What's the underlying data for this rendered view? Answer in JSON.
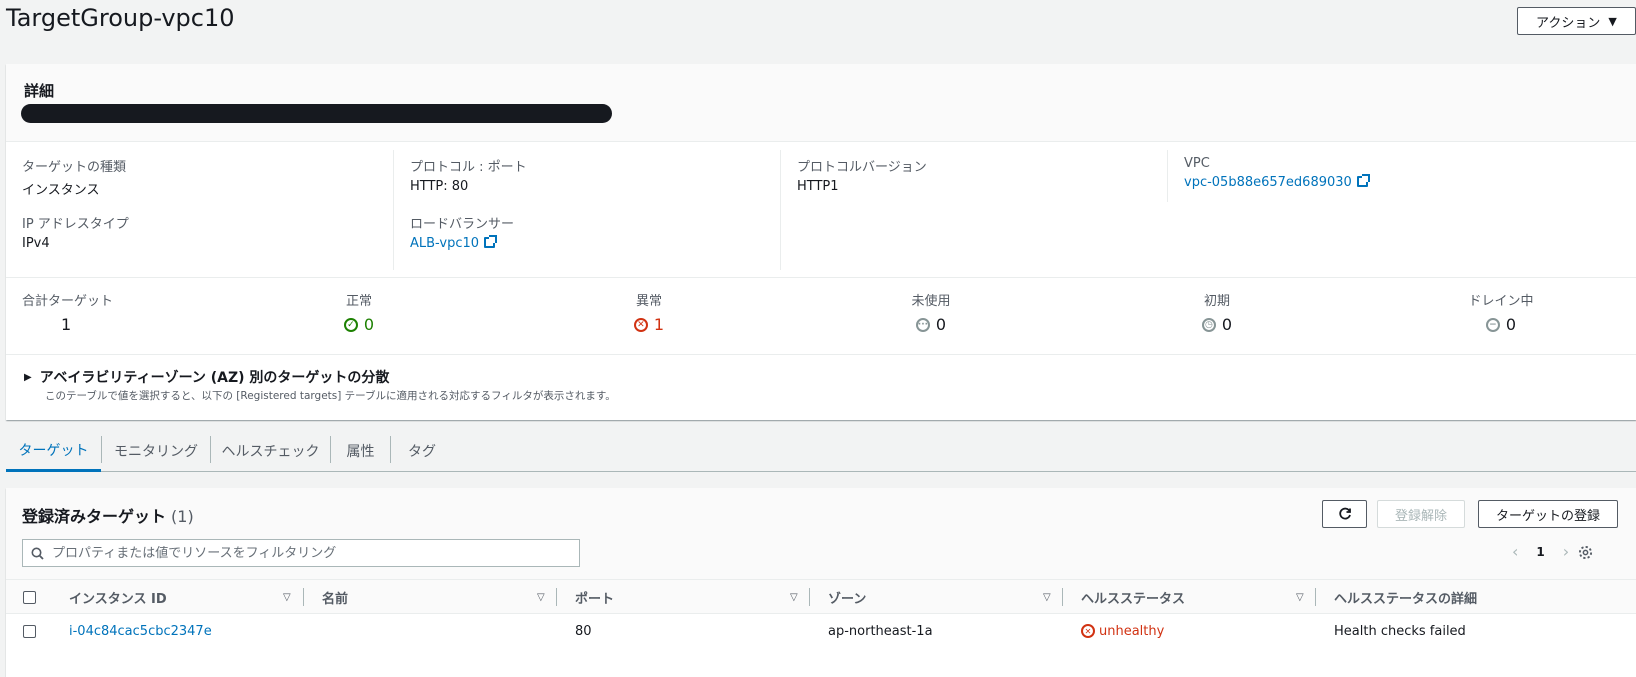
{
  "page": {
    "title": "TargetGroup-vpc10",
    "actions_label": "アクション"
  },
  "details": {
    "heading": "詳細",
    "target_type": {
      "label": "ターゲットの種類",
      "value": "インスタンス"
    },
    "ip_type": {
      "label": "IP アドレスタイプ",
      "value": "IPv4"
    },
    "protocol_port": {
      "label": "プロトコル : ポート",
      "value": "HTTP: 80"
    },
    "load_balancer": {
      "label": "ロードバランサー",
      "value": "ALB-vpc10"
    },
    "protocol_version": {
      "label": "プロトコルバージョン",
      "value": "HTTP1"
    },
    "vpc": {
      "label": "VPC",
      "value": "vpc-05b88e657ed689030"
    }
  },
  "stats": {
    "total": {
      "label": "合計ターゲット",
      "value": "1"
    },
    "healthy": {
      "label": "正常",
      "value": "0"
    },
    "unhealthy": {
      "label": "異常",
      "value": "1"
    },
    "unused": {
      "label": "未使用",
      "value": "0"
    },
    "initial": {
      "label": "初期",
      "value": "0"
    },
    "draining": {
      "label": "ドレイン中",
      "value": "0"
    }
  },
  "az": {
    "title": "アベイラビリティーゾーン (AZ) 別のターゲットの分散",
    "desc": "このテーブルで値を選択すると、以下の [Registered targets] テーブルに適用される対応するフィルタが表示されます。"
  },
  "tabs": [
    "ターゲット",
    "モニタリング",
    "ヘルスチェック",
    "属性",
    "タグ"
  ],
  "targets": {
    "title": "登録済みターゲット",
    "count": "(1)",
    "deregister_label": "登録解除",
    "register_label": "ターゲットの登録",
    "search_placeholder": "プロパティまたは値でリソースをフィルタリング",
    "page": "1",
    "columns": [
      "インスタンス ID",
      "名前",
      "ポート",
      "ゾーン",
      "ヘルスステータス",
      "ヘルスステータスの詳細"
    ],
    "rows": [
      {
        "instance_id": "i-04c84cac5cbc2347e",
        "name": "",
        "port": "80",
        "zone": "ap-northeast-1a",
        "health": "unhealthy",
        "health_detail": "Health checks failed"
      }
    ]
  },
  "colors": {
    "link": "#0073bb",
    "healthy": "#1d8102",
    "unhealthy": "#d13212"
  }
}
